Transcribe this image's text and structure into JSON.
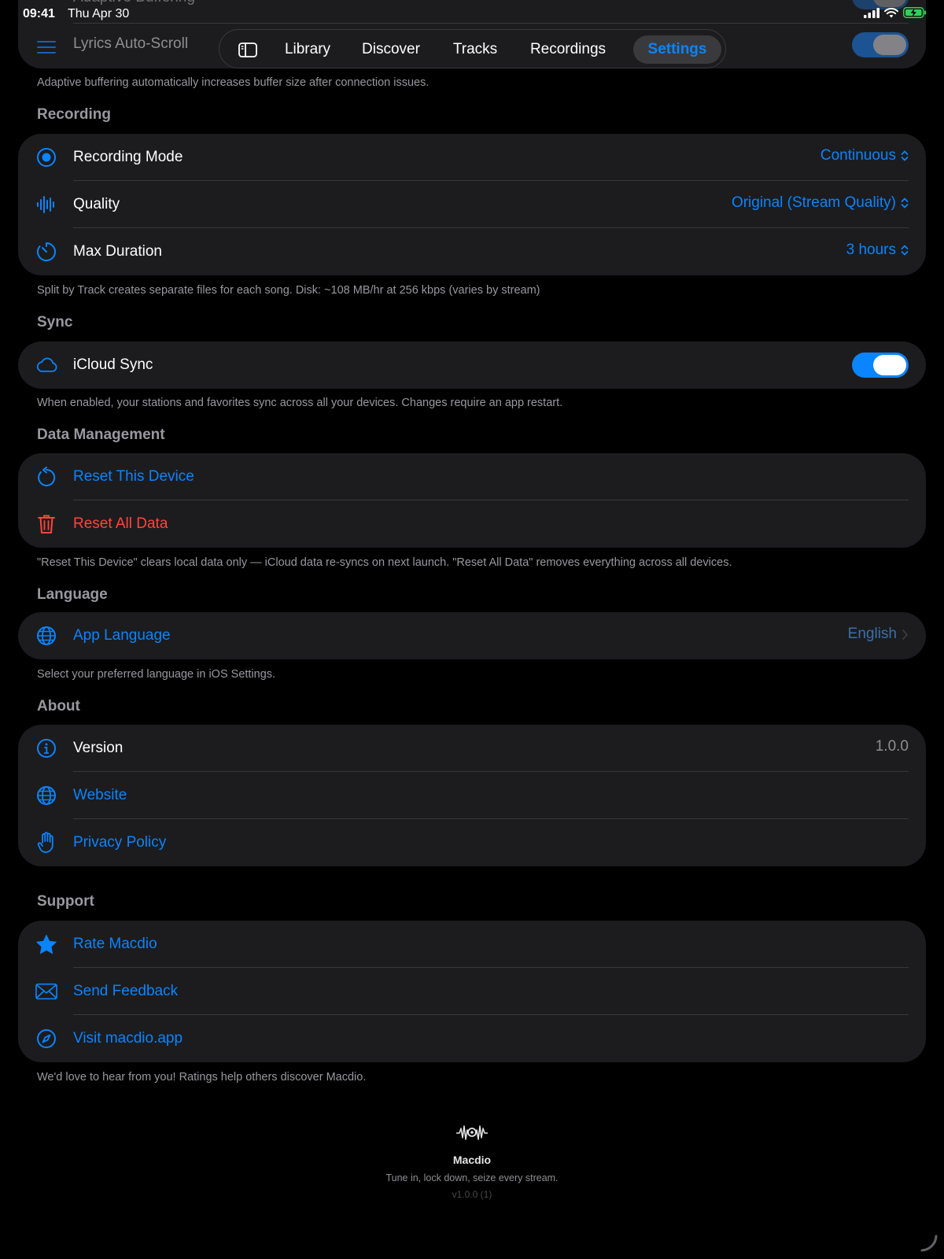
{
  "status_bar": {
    "time": "09:41",
    "date": "Thu Apr 30"
  },
  "tab_bar": {
    "tabs": [
      {
        "label": "Library"
      },
      {
        "label": "Discover"
      },
      {
        "label": "Tracks"
      },
      {
        "label": "Recordings"
      },
      {
        "label": "Settings"
      }
    ],
    "active_tab": "Settings"
  },
  "playback": {
    "partial_row_label": "Adaptive Buffering",
    "lyrics_label": "Lyrics Auto-Scroll",
    "footnote": "Adaptive buffering automatically increases buffer size after connection issues."
  },
  "recording": {
    "title": "Recording",
    "mode_label": "Recording Mode",
    "mode_value": "Continuous",
    "quality_label": "Quality",
    "quality_value": "Original (Stream Quality)",
    "duration_label": "Max Duration",
    "duration_value": "3 hours",
    "footnote": "Split by Track creates separate files for each song. Disk: ~108 MB/hr at 256 kbps (varies by stream)"
  },
  "sync": {
    "title": "Sync",
    "icloud_label": "iCloud Sync",
    "icloud_on": true,
    "footnote": "When enabled, your stations and favorites sync across all your devices. Changes require an app restart."
  },
  "data_management": {
    "title": "Data Management",
    "reset_device_label": "Reset This Device",
    "reset_all_label": "Reset All Data",
    "footnote": "\"Reset This Device\" clears local data only — iCloud data re-syncs on next launch. \"Reset All Data\" removes everything across all devices."
  },
  "language": {
    "title": "Language",
    "app_language_label": "App Language",
    "app_language_value": "English",
    "footnote": "Select your preferred language in iOS Settings."
  },
  "about": {
    "title": "About",
    "version_label": "Version",
    "version_value": "1.0.0",
    "website_label": "Website",
    "privacy_label": "Privacy Policy"
  },
  "support": {
    "title": "Support",
    "rate_label": "Rate Macdio",
    "feedback_label": "Send Feedback",
    "visit_label": "Visit macdio.app",
    "footnote": "We'd love to hear from you! Ratings help others discover Macdio."
  },
  "branding": {
    "app_name": "Macdio",
    "tagline": "Tune in, lock down, seize every stream.",
    "version": "v1.0.0 (1)"
  },
  "colors": {
    "accent": "#0a84ff",
    "destructive": "#ff453a",
    "card": "#1c1c1e",
    "background": "#000000"
  }
}
